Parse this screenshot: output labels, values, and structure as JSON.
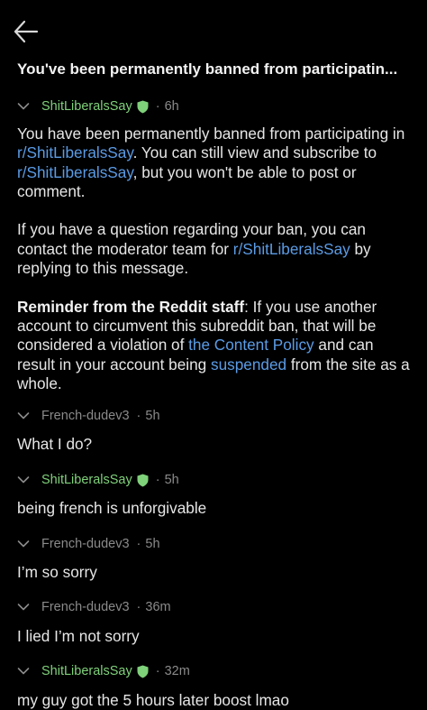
{
  "header": {
    "title": "You've been permanently banned from participatin..."
  },
  "message": {
    "author": "ShitLiberalsSay",
    "time": "6h",
    "p1_a": "You have been permanently banned from participating in ",
    "p1_link1": "r/ShitLiberalsSay",
    "p1_b": ". You can still view and subscribe to ",
    "p1_link2": "r/ShitLiberalsSay",
    "p1_c": ", but you won't be able to post or comment.",
    "p2_a": "If you have a question regarding your ban, you can contact the moderator team for ",
    "p2_link": "r/ShitLiberalsSay",
    "p2_b": " by replying to this message.",
    "p3_bold": "Reminder from the Reddit staff",
    "p3_a": ": If you use another account to circumvent this subreddit ban, that will be considered a violation of ",
    "p3_link1": "the Content Policy",
    "p3_b": " and can result in your account being ",
    "p3_link2": "suspended",
    "p3_c": " from the site as a whole."
  },
  "replies": [
    {
      "author": "French-dudev3",
      "time": "5h",
      "text": "What I do?",
      "mod": false
    },
    {
      "author": "ShitLiberalsSay",
      "time": "5h",
      "text": "being french is unforgivable",
      "mod": true
    },
    {
      "author": "French-dudev3",
      "time": "5h",
      "text": "I’m so sorry",
      "mod": false
    },
    {
      "author": "French-dudev3",
      "time": "36m",
      "text": "I lied I’m not sorry",
      "mod": false
    },
    {
      "author": "ShitLiberalsSay",
      "time": "32m",
      "text": "my guy got the 5 hours later boost lmao",
      "mod": true
    }
  ],
  "separator": "·",
  "colors": {
    "background": "#000000",
    "mod_green": "#7fd17a",
    "link_blue": "#5b9ce6",
    "muted": "#8a8a8a"
  },
  "icons": {
    "back": "arrow-left-icon",
    "collapse": "chevron-down-icon",
    "mod_badge": "shield-icon"
  }
}
